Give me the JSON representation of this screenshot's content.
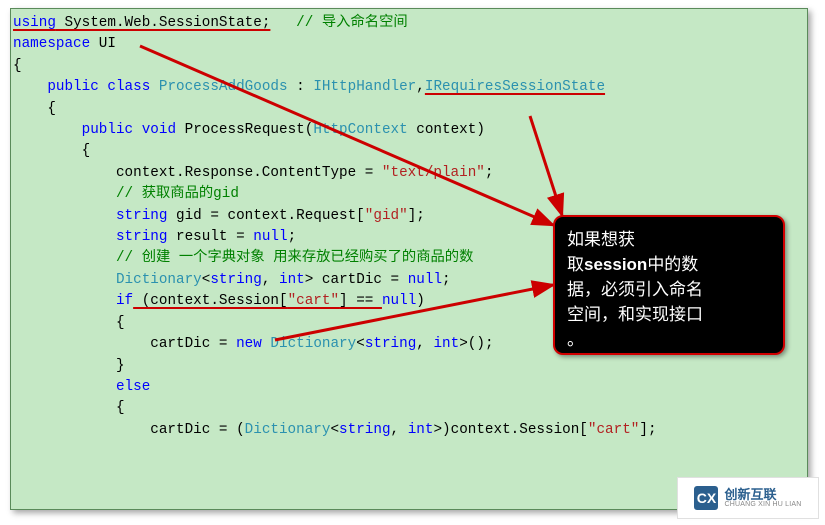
{
  "code": {
    "l1_using": "using",
    "l1_ns": " System.Web.SessionState;",
    "l1_comment": "   // 导入命名空间",
    "l2_ns": "namespace",
    "l2_name": " UI",
    "l3": "{",
    "l4_pub": "    public",
    "l4_class": " class",
    "l4_name": " ProcessAddGoods",
    "l4_colon": " : ",
    "l4_t1": "IHttpHandler",
    "l4_comma": ",",
    "l4_t2": "IRequiresSessionState",
    "l5": "    {",
    "l6_pub": "        public",
    "l6_void": " void",
    "l6_name": " ProcessRequest(",
    "l6_type": "HttpContext",
    "l6_rest": " context)",
    "l7": "        {",
    "l8_a": "            context.Response.ContentType = ",
    "l8_s": "\"text/plain\"",
    "l8_b": ";",
    "l9": "            // 获取商品的gid",
    "l10_kw": "            string",
    "l10_a": " gid = context.Request[",
    "l10_s": "\"gid\"",
    "l10_b": "];",
    "l11_kw": "            string",
    "l11_a": " result = ",
    "l11_null": "null",
    "l11_b": ";",
    "l12": "            // 创建 一个字典对象 用来存放已经购买了的商品的数",
    "l13_type": "            Dictionary",
    "l13_a": "<",
    "l13_str": "string",
    "l13_b": ", ",
    "l13_int": "int",
    "l13_c": "> cartDic = ",
    "l13_null": "null",
    "l13_d": ";",
    "l14_if": "            if",
    "l14_a": " (context.Session[",
    "l14_s": "\"cart\"",
    "l14_b": "] == ",
    "l14_null": "null",
    "l14_c": ")",
    "l15": "            {",
    "l16_a": "                cartDic = ",
    "l16_new": "new",
    "l16_sp": " ",
    "l16_type": "Dictionary",
    "l16_b": "<",
    "l16_str": "string",
    "l16_c": ", ",
    "l16_int": "int",
    "l16_d": ">();",
    "l17": "            }",
    "l18": "            else",
    "l19": "            {",
    "l20_a": "                cartDic = (",
    "l20_type": "Dictionary",
    "l20_b": "<",
    "l20_str": "string",
    "l20_c": ", ",
    "l20_int": "int",
    "l20_d": ">)context.Session[",
    "l20_s": "\"cart\"",
    "l20_e": "];"
  },
  "callout": {
    "t1": "如果想获",
    "t2a": "取",
    "t2b": "session",
    "t2c": "中的数",
    "t3": "据，必须引入命名",
    "t4": "空间，和实现接口",
    "t5": "。"
  },
  "watermark": {
    "cn": "创新互联",
    "py": "CHUANG XIN HU LIAN"
  }
}
